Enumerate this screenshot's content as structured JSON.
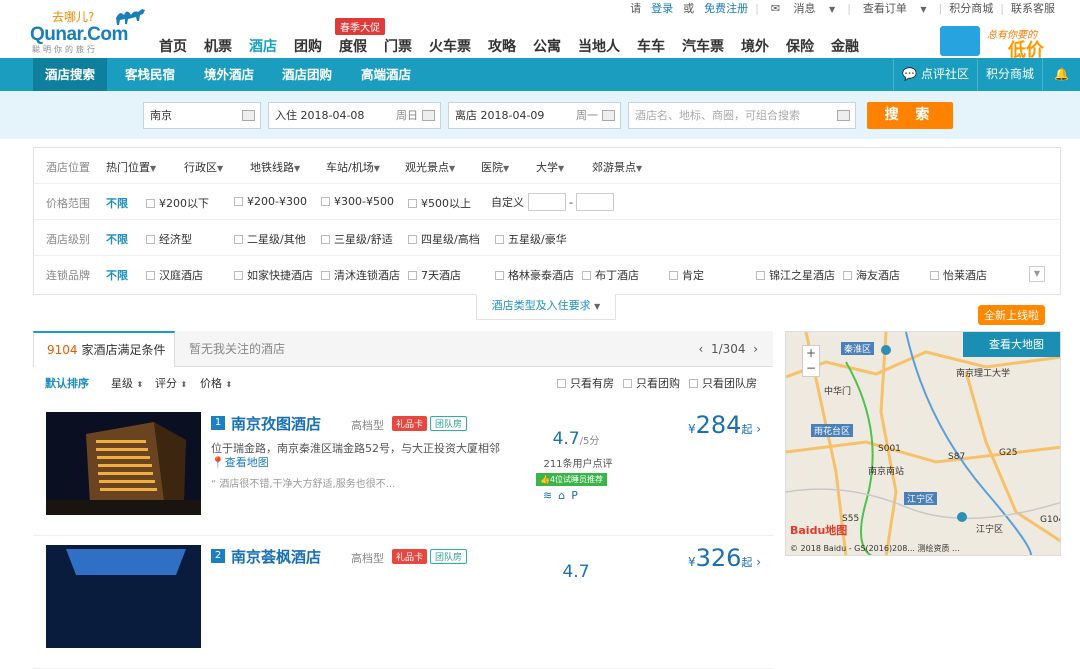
{
  "logo": {
    "brand": "Qunar.Com",
    "slogan": "聪明你的旅行",
    "tagline": "去哪儿?"
  },
  "top_links": {
    "greet": "请",
    "login": "登录",
    "or": "或",
    "register": "免费注册",
    "messages": "消息",
    "orders": "查看订单",
    "points": "积分商城",
    "contact": "联系客服"
  },
  "nav": {
    "items": [
      "首页",
      "机票",
      "酒店",
      "团购",
      "度假",
      "门票",
      "火车票",
      "攻略",
      "公寓",
      "当地人",
      "车车",
      "汽车票",
      "境外",
      "保险",
      "金融"
    ],
    "active": "酒店",
    "promo": "春季大促"
  },
  "ad": {
    "line1": "总有你要的",
    "line2": "低价"
  },
  "subnav": {
    "items": [
      "酒店搜索",
      "客栈民宿",
      "境外酒店",
      "酒店团购",
      "高端酒店"
    ],
    "right": [
      "点评社区",
      "积分商城"
    ]
  },
  "search": {
    "city": "南京",
    "checkin_label": "入住",
    "checkin": "2018-04-08",
    "checkin_day": "周日",
    "checkout_label": "离店",
    "checkout": "2018-04-09",
    "checkout_day": "周一",
    "keyword_placeholder": "酒店名、地标、商圈，可组合搜索",
    "button": "搜 索"
  },
  "filters": {
    "location": {
      "label": "酒店位置",
      "options": [
        "热门位置",
        "行政区",
        "地铁线路",
        "车站/机场",
        "观光景点",
        "医院",
        "大学",
        "郊游景点"
      ]
    },
    "price": {
      "label": "价格范围",
      "nolimit": "不限",
      "options": [
        "¥200以下",
        "¥200-¥300",
        "¥300-¥500",
        "¥500以上"
      ],
      "custom": "自定义",
      "dash": "-"
    },
    "star": {
      "label": "酒店级别",
      "nolimit": "不限",
      "options": [
        "经济型",
        "二星级/其他",
        "三星级/舒适",
        "四星级/高档",
        "五星级/豪华"
      ]
    },
    "chain": {
      "label": "连锁品牌",
      "nolimit": "不限",
      "options": [
        "汉庭酒店",
        "如家快捷酒店",
        "清沐连锁酒店",
        "7天酒店",
        "格林豪泰酒店",
        "布丁酒店",
        "肯定",
        "锦江之星酒店",
        "海友酒店",
        "怡莱酒店"
      ]
    },
    "more": "酒店类型及入住要求"
  },
  "results": {
    "count": "9104",
    "count_suffix": "家酒店满足条件",
    "tab2": "暂无我关注的酒店",
    "page": "1/304"
  },
  "sort": {
    "default": "默认排序",
    "star": "星级",
    "score": "评分",
    "price": "价格",
    "checks": [
      "只看有房",
      "只看团购",
      "只看团队房"
    ]
  },
  "hotels": [
    {
      "index": "1",
      "name": "南京孜图酒店",
      "level": "高档型",
      "gift": "礼品卡",
      "group": "团队房",
      "address": "位于瑞金路，南京秦淮区瑞金路52号，与大正投资大厦相邻",
      "map": "查看地图",
      "review": "酒店很不错,干净大方舒适,服务也很不...",
      "score": "4.7",
      "score_max": "/5分",
      "reviews": "211条用户点评",
      "badge": "4位试睡员推荐",
      "price_cur": "¥",
      "price": "284",
      "price_suffix": "起"
    },
    {
      "index": "2",
      "name": "南京荟枫酒店",
      "level": "高档型",
      "gift": "礼品卡",
      "group": "团队房",
      "score": "4.7",
      "price_cur": "¥",
      "price": "326",
      "price_suffix": "起"
    }
  ],
  "map": {
    "tag": "全新上线啦",
    "button": "查看大地图",
    "districts": [
      "秦淮区",
      "雨花台区",
      "江宁区"
    ],
    "places": [
      "南京理工大学",
      "南京南站",
      "中华门",
      "江宁区"
    ],
    "roads": [
      "S001",
      "S87",
      "G25",
      "S55",
      "G104"
    ],
    "copyright": "© 2018 Baidu - GS(2016)208... 测绘资质 ...",
    "baidu": "Baidu地图"
  }
}
